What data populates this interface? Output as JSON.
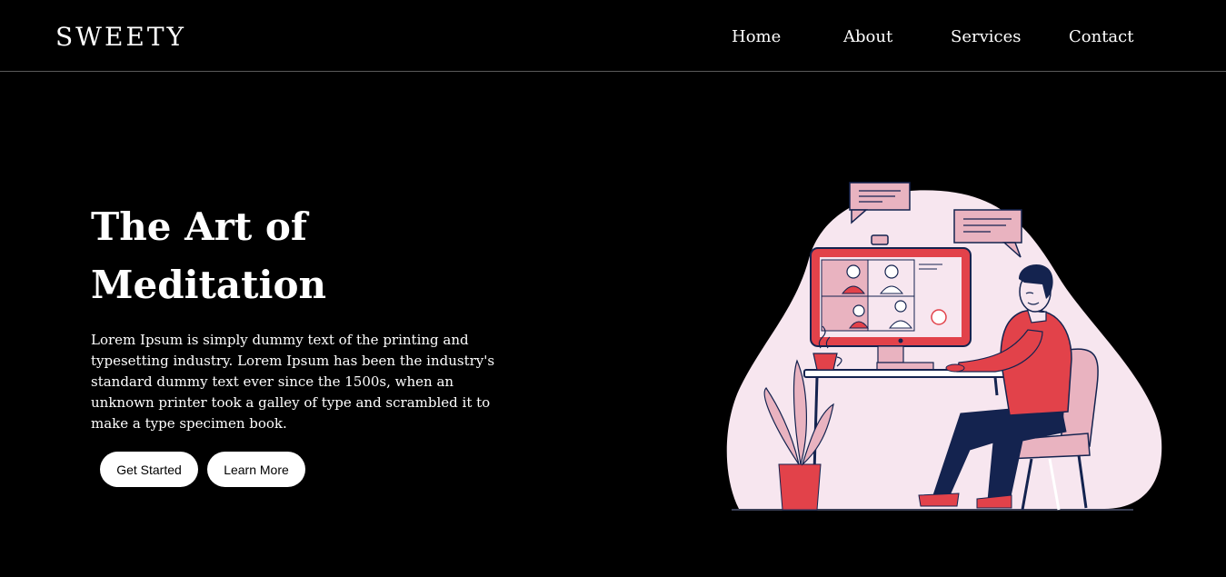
{
  "header": {
    "brand": "SWEETY",
    "nav": [
      "Home",
      "About",
      "Services",
      "Contact"
    ]
  },
  "hero": {
    "title_line1": "The Art of",
    "title_line2": "Meditation",
    "description": "Lorem Ipsum is simply dummy text of the printing and typesetting industry. Lorem Ipsum has been the industry's standard dummy text ever since the 1500s, when an unknown printer took a galley of type and scrambled it to make a type specimen book.",
    "primary_button": "Get Started",
    "secondary_button": "Learn More"
  },
  "colors": {
    "background": "#000000",
    "text": "#ffffff",
    "accent_red": "#e2424a",
    "blob_pink": "#f7e6ef",
    "navy": "#14234f"
  }
}
